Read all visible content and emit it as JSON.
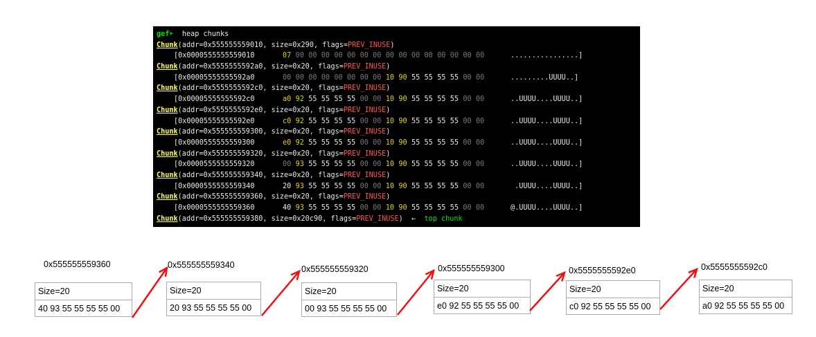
{
  "terminal": {
    "prompt": "gef➤",
    "command": "  heap chunks",
    "chunk_word": "Chunk",
    "chunks": [
      {
        "header": "(addr=0x555555559010, size=0x290, flags=",
        "flag": "PREV_INUSE",
        "tail": ")",
        "dump_addr": "[0x0000555555559010",
        "bytes": [
          [
            "07",
            "y"
          ],
          [
            "00",
            "z"
          ],
          [
            "00",
            "z"
          ],
          [
            "00",
            "z"
          ],
          [
            "00",
            "z"
          ],
          [
            "00",
            "z"
          ],
          [
            "00",
            "z"
          ],
          [
            "00",
            "z"
          ],
          [
            "00",
            "z"
          ],
          [
            "00",
            "z"
          ],
          [
            "00",
            "z"
          ],
          [
            "00",
            "z"
          ],
          [
            "00",
            "z"
          ],
          [
            "00",
            "z"
          ],
          [
            "00",
            "z"
          ],
          [
            "00",
            "z"
          ]
        ],
        "ascii": "................]"
      },
      {
        "header": "(addr=0x5555555592a0, size=0x20, flags=",
        "flag": "PREV_INUSE",
        "tail": ")",
        "dump_addr": "[0x00005555555592a0",
        "bytes": [
          [
            "00",
            "z"
          ],
          [
            "00",
            "z"
          ],
          [
            "00",
            "z"
          ],
          [
            "00",
            "z"
          ],
          [
            "00",
            "z"
          ],
          [
            "00",
            "z"
          ],
          [
            "00",
            "z"
          ],
          [
            "00",
            "z"
          ],
          [
            "10",
            "y"
          ],
          [
            "90",
            "y"
          ],
          [
            "55",
            "n"
          ],
          [
            "55",
            "n"
          ],
          [
            "55",
            "n"
          ],
          [
            "55",
            "n"
          ],
          [
            "00",
            "z"
          ],
          [
            "00",
            "z"
          ]
        ],
        "ascii": ".........UUUU..]"
      },
      {
        "header": "(addr=0x5555555592c0, size=0x20, flags=",
        "flag": "PREV_INUSE",
        "tail": ")",
        "dump_addr": "[0x00005555555592c0",
        "bytes": [
          [
            "a0",
            "y"
          ],
          [
            "92",
            "y"
          ],
          [
            "55",
            "n"
          ],
          [
            "55",
            "n"
          ],
          [
            "55",
            "n"
          ],
          [
            "55",
            "n"
          ],
          [
            "00",
            "z"
          ],
          [
            "00",
            "z"
          ],
          [
            "10",
            "y"
          ],
          [
            "90",
            "y"
          ],
          [
            "55",
            "n"
          ],
          [
            "55",
            "n"
          ],
          [
            "55",
            "n"
          ],
          [
            "55",
            "n"
          ],
          [
            "00",
            "z"
          ],
          [
            "00",
            "z"
          ]
        ],
        "ascii": "..UUUU....UUUU..]"
      },
      {
        "header": "(addr=0x5555555592e0, size=0x20, flags=",
        "flag": "PREV_INUSE",
        "tail": ")",
        "dump_addr": "[0x00005555555592e0",
        "bytes": [
          [
            "c0",
            "y"
          ],
          [
            "92",
            "y"
          ],
          [
            "55",
            "n"
          ],
          [
            "55",
            "n"
          ],
          [
            "55",
            "n"
          ],
          [
            "55",
            "n"
          ],
          [
            "00",
            "z"
          ],
          [
            "00",
            "z"
          ],
          [
            "10",
            "y"
          ],
          [
            "90",
            "y"
          ],
          [
            "55",
            "n"
          ],
          [
            "55",
            "n"
          ],
          [
            "55",
            "n"
          ],
          [
            "55",
            "n"
          ],
          [
            "00",
            "z"
          ],
          [
            "00",
            "z"
          ]
        ],
        "ascii": "..UUUU....UUUU..]"
      },
      {
        "header": "(addr=0x555555559300, size=0x20, flags=",
        "flag": "PREV_INUSE",
        "tail": ")",
        "dump_addr": "[0x0000555555559300",
        "bytes": [
          [
            "e0",
            "y"
          ],
          [
            "92",
            "y"
          ],
          [
            "55",
            "n"
          ],
          [
            "55",
            "n"
          ],
          [
            "55",
            "n"
          ],
          [
            "55",
            "n"
          ],
          [
            "00",
            "z"
          ],
          [
            "00",
            "z"
          ],
          [
            "10",
            "y"
          ],
          [
            "90",
            "y"
          ],
          [
            "55",
            "n"
          ],
          [
            "55",
            "n"
          ],
          [
            "55",
            "n"
          ],
          [
            "55",
            "n"
          ],
          [
            "00",
            "z"
          ],
          [
            "00",
            "z"
          ]
        ],
        "ascii": "..UUUU....UUUU..]"
      },
      {
        "header": "(addr=0x555555559320, size=0x20, flags=",
        "flag": "PREV_INUSE",
        "tail": ")",
        "dump_addr": "[0x0000555555559320",
        "bytes": [
          [
            "00",
            "z"
          ],
          [
            "93",
            "y"
          ],
          [
            "55",
            "n"
          ],
          [
            "55",
            "n"
          ],
          [
            "55",
            "n"
          ],
          [
            "55",
            "n"
          ],
          [
            "00",
            "z"
          ],
          [
            "00",
            "z"
          ],
          [
            "10",
            "y"
          ],
          [
            "90",
            "y"
          ],
          [
            "55",
            "n"
          ],
          [
            "55",
            "n"
          ],
          [
            "55",
            "n"
          ],
          [
            "55",
            "n"
          ],
          [
            "00",
            "z"
          ],
          [
            "00",
            "z"
          ]
        ],
        "ascii": "..UUUU....UUUU..]"
      },
      {
        "header": "(addr=0x555555559340, size=0x20, flags=",
        "flag": "PREV_INUSE",
        "tail": ")",
        "dump_addr": "[0x0000555555559340",
        "bytes": [
          [
            "20",
            "n"
          ],
          [
            "93",
            "y"
          ],
          [
            "55",
            "n"
          ],
          [
            "55",
            "n"
          ],
          [
            "55",
            "n"
          ],
          [
            "55",
            "n"
          ],
          [
            "00",
            "z"
          ],
          [
            "00",
            "z"
          ],
          [
            "10",
            "y"
          ],
          [
            "90",
            "y"
          ],
          [
            "55",
            "n"
          ],
          [
            "55",
            "n"
          ],
          [
            "55",
            "n"
          ],
          [
            "55",
            "n"
          ],
          [
            "00",
            "z"
          ],
          [
            "00",
            "z"
          ]
        ],
        "ascii": " .UUUU....UUUU..]"
      },
      {
        "header": "(addr=0x555555559360, size=0x20, flags=",
        "flag": "PREV_INUSE",
        "tail": ")",
        "dump_addr": "[0x0000555555559360",
        "bytes": [
          [
            "40",
            "n"
          ],
          [
            "93",
            "y"
          ],
          [
            "55",
            "n"
          ],
          [
            "55",
            "n"
          ],
          [
            "55",
            "n"
          ],
          [
            "55",
            "n"
          ],
          [
            "00",
            "z"
          ],
          [
            "00",
            "z"
          ],
          [
            "10",
            "y"
          ],
          [
            "90",
            "y"
          ],
          [
            "55",
            "n"
          ],
          [
            "55",
            "n"
          ],
          [
            "55",
            "n"
          ],
          [
            "55",
            "n"
          ],
          [
            "00",
            "z"
          ],
          [
            "00",
            "z"
          ]
        ],
        "ascii": "@.UUUU....UUUU..]"
      }
    ],
    "last_chunk": {
      "header": "(addr=0x555555559380, size=0x20c90, flags=",
      "flag": "PREV_INUSE",
      "tail": ")",
      "arrow": "  ←  ",
      "note": "top chunk"
    }
  },
  "diagram": {
    "nodes": [
      {
        "addr": "0x555555559360",
        "size": "Size=20",
        "fd": "40 93 55 55 55 55 00"
      },
      {
        "addr": "0x555555559340",
        "size": "Size=20",
        "fd": "20 93 55 55 55 55 00"
      },
      {
        "addr": "0x555555559320",
        "size": "Size=20",
        "fd": "00 93 55 55 55 55 00"
      },
      {
        "addr": "0x555555559300",
        "size": "Size=20",
        "fd": "e0 92 55 55 55 55 00"
      },
      {
        "addr": "0x5555555592e0",
        "size": "Size=20",
        "fd": "c0 92 55 55 55 55 00"
      },
      {
        "addr": "0x5555555592c0",
        "size": "Size=20",
        "fd": "a0 92 55 55 55 55 00"
      }
    ],
    "arrow_color": "#ee1111"
  }
}
